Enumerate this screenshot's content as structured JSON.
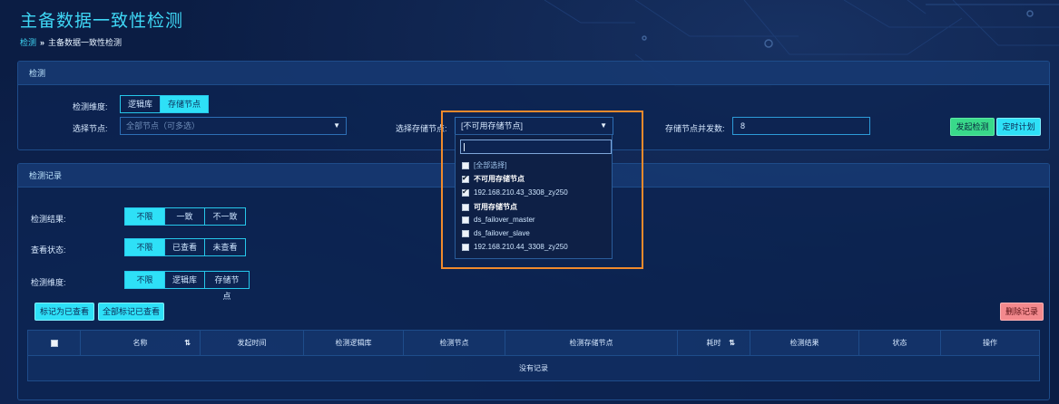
{
  "page": {
    "title": "主备数据一致性检测",
    "breadcrumb": {
      "root": "检测",
      "separator": "»",
      "current": "主备数据一致性检测"
    }
  },
  "detect_panel": {
    "title": "检测",
    "dimension_label": "检测维度:",
    "dimension_options": [
      "逻辑库",
      "存储节点"
    ],
    "dimension_active": "存储节点",
    "node_label": "选择节点:",
    "node_placeholder": "全部节点（可多选）",
    "storage_label": "选择存储节点:",
    "storage_value": "[不可用存储节点]",
    "concurrency_label": "存储节点并发数:",
    "concurrency_value": "8",
    "start_button": "发起检测",
    "schedule_button": "定时计划"
  },
  "storage_dropdown": {
    "search_value": "",
    "select_all": "[全部选择]",
    "groups": [
      {
        "label": "不可用存储节点",
        "checked": true,
        "items": [
          {
            "label": "192.168.210.43_3308_zy250",
            "checked": true
          }
        ]
      },
      {
        "label": "可用存储节点",
        "checked": false,
        "items": [
          {
            "label": "ds_failover_master",
            "checked": false
          },
          {
            "label": "ds_failover_slave",
            "checked": false
          },
          {
            "label": "192.168.210.44_3308_zy250",
            "checked": false
          }
        ]
      }
    ]
  },
  "records_panel": {
    "title": "检测记录",
    "filters": [
      {
        "label": "检测结果:",
        "options": [
          "不限",
          "一致",
          "不一致"
        ],
        "active": "不限"
      },
      {
        "label": "查看状态:",
        "options": [
          "不限",
          "已查看",
          "未查看"
        ],
        "active": "不限"
      },
      {
        "label": "检测维度:",
        "options": [
          "不限",
          "逻辑库",
          "存储节点"
        ],
        "active": "不限"
      }
    ],
    "mark_viewed_button": "标记为已查看",
    "mark_all_button": "全部标记已查看",
    "delete_button": "删除记录",
    "table": {
      "columns": [
        "",
        "名称",
        "发起时间",
        "检测逻辑库",
        "检测节点",
        "检测存储节点",
        "耗时",
        "检测结果",
        "状态",
        "操作"
      ],
      "empty_text": "没有记录"
    }
  },
  "colors": {
    "accent": "#2ee0f7",
    "title": "#3fd7f5",
    "green": "#39d98a",
    "pink": "#f3898d",
    "highlight": "#f08a2c"
  }
}
